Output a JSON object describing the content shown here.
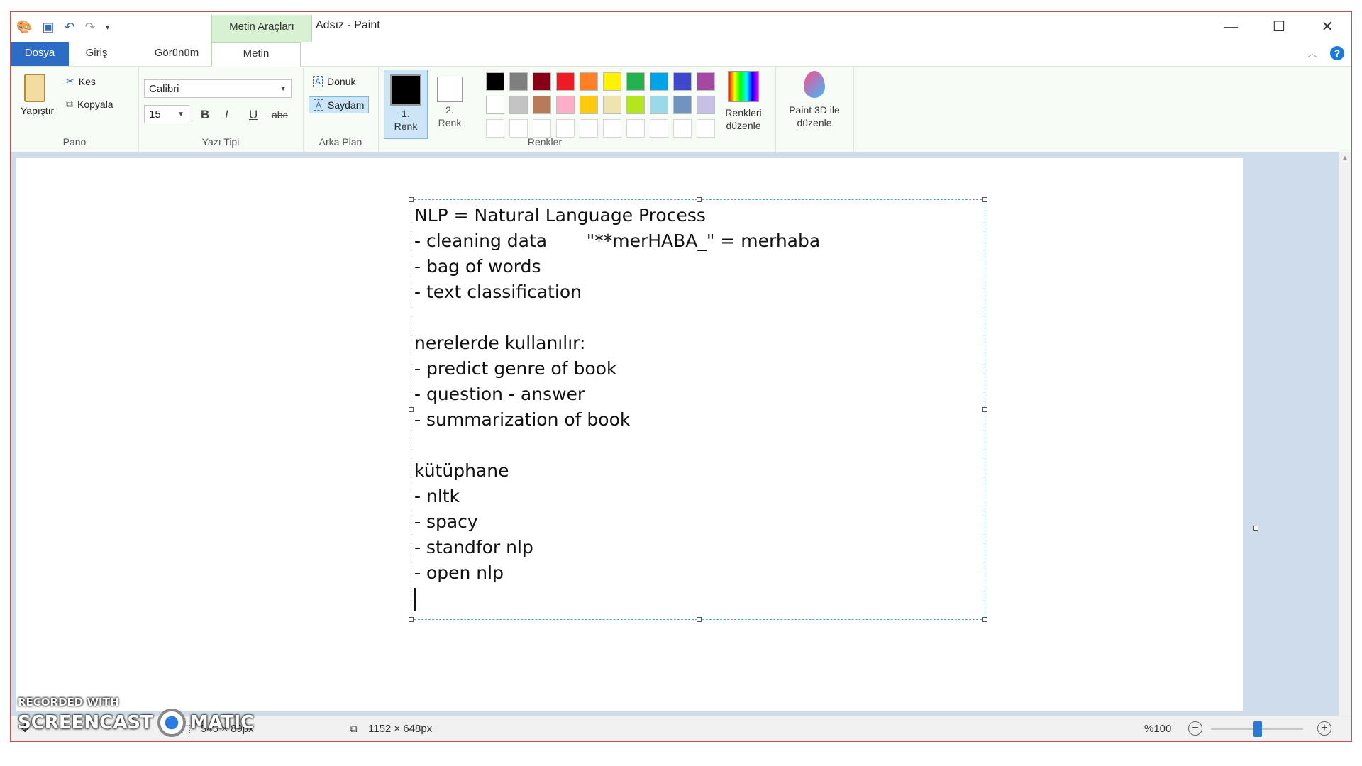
{
  "app": {
    "window_title": "Adsız - Paint",
    "contextual_tab": "Metin Araçları"
  },
  "tabs": [
    {
      "label": "Dosya"
    },
    {
      "label": "Giriş"
    },
    {
      "label": "Görünüm"
    },
    {
      "label": "Metin"
    }
  ],
  "ribbon": {
    "clipboard": {
      "paste": "Yapıştır",
      "cut": "Kes",
      "copy": "Kopyala",
      "group": "Pano"
    },
    "font": {
      "family": "Calibri",
      "size": "15",
      "bold": "B",
      "italic": "I",
      "underline": "U",
      "strike": "abc",
      "group": "Yazı Tipi"
    },
    "background": {
      "opaque": "Donuk",
      "transparent": "Saydam",
      "group": "Arka Plan"
    },
    "colors": {
      "color1": "1. Renk",
      "color2": "2. Renk",
      "edit": "Renkleri düzenle",
      "paint3d": "Paint 3D ile düzenle",
      "group": "Renkler",
      "palette_row1": [
        "#000000",
        "#7f7f7f",
        "#880015",
        "#ed1c24",
        "#ff7f27",
        "#fff200",
        "#22b14c",
        "#00a2e8",
        "#3f48cc",
        "#a349a4"
      ],
      "palette_row2": [
        "#ffffff",
        "#c3c3c3",
        "#b97a57",
        "#ffaec9",
        "#ffc90e",
        "#efe4b0",
        "#b5e61d",
        "#99d9ea",
        "#7092be",
        "#c8bfe7"
      ]
    }
  },
  "canvas_text": [
    "NLP = Natural Language Process",
    "- cleaning data       \"**merHABA_\" = merhaba",
    "- bag of words",
    "- text classification",
    "",
    "nerelerde kullanılır:",
    "- predict genre of book",
    "- question - answer",
    "- summarization of book",
    "",
    "kütüphane",
    "- nltk",
    "- spacy",
    "- standfor nlp",
    "- open nlp"
  ],
  "status": {
    "selection_size": "545 × 89px",
    "image_size": "1152 × 648px",
    "zoom": "%100"
  },
  "watermark": {
    "line1": "RECORDED WITH",
    "line2": "SCREENCAST",
    "line3": "MATIC"
  }
}
